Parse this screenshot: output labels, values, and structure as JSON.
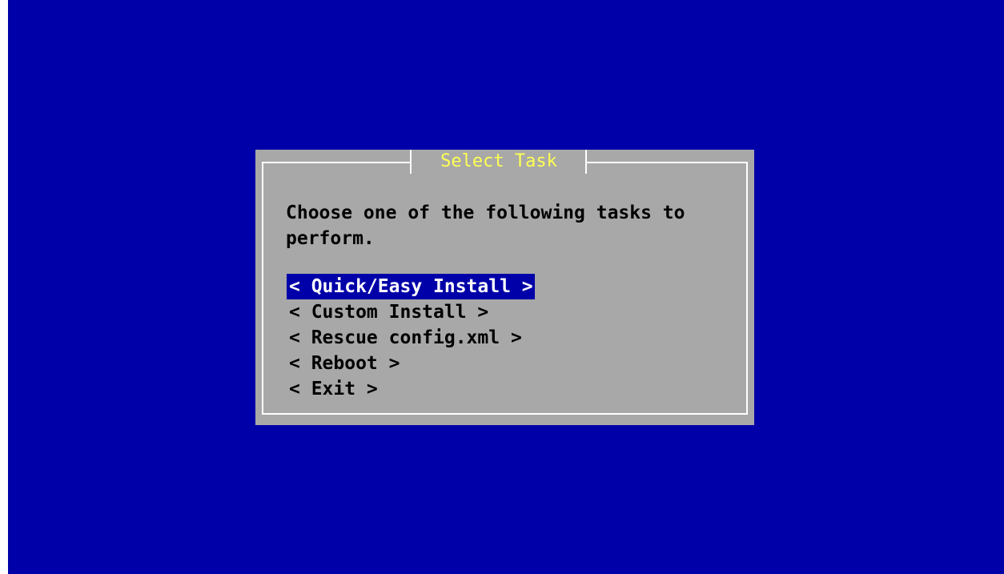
{
  "dialog": {
    "title": "Select Task",
    "prompt": "Choose one of the following tasks to\nperform.",
    "options": [
      {
        "label": "< Quick/Easy Install >",
        "selected": true
      },
      {
        "label": "< Custom Install >",
        "selected": false
      },
      {
        "label": "< Rescue config.xml >",
        "selected": false
      },
      {
        "label": "< Reboot >",
        "selected": false
      },
      {
        "label": "< Exit >",
        "selected": false
      }
    ]
  },
  "colors": {
    "screen_background": "#0000a8",
    "dialog_background": "#a8a8a8",
    "title_text": "#ffff54",
    "selection_background": "#0000a8",
    "selection_text": "#ffffff"
  }
}
